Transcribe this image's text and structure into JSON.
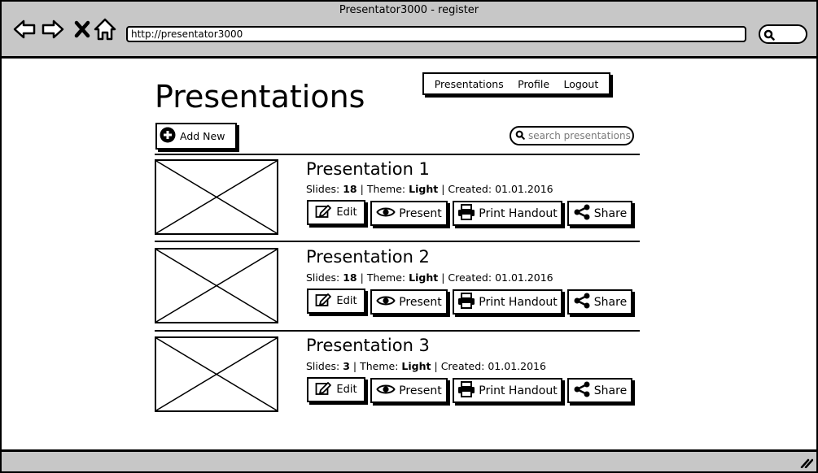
{
  "browser": {
    "title": "Presentator3000 - register",
    "url": "http://presentator3000"
  },
  "page": {
    "title": "Presentations"
  },
  "nav": {
    "items": [
      "Presentations",
      "Profile",
      "Logout"
    ]
  },
  "toolbar": {
    "add_new_label": "Add New",
    "search_placeholder": "search presentations"
  },
  "labels": {
    "slides": "Slides:",
    "theme": "Theme:",
    "created": "Created:",
    "sep": "|"
  },
  "actions": {
    "edit": "Edit",
    "present": "Present",
    "print": "Print Handout",
    "share": "Share"
  },
  "presentations": [
    {
      "name": "Presentation 1",
      "slides": "18",
      "theme": "Light",
      "created": "01.01.2016"
    },
    {
      "name": "Presentation 2",
      "slides": "18",
      "theme": "Light",
      "created": "01.01.2016"
    },
    {
      "name": "Presentation 3",
      "slides": "3",
      "theme": "Light",
      "created": "01.01.2016"
    }
  ]
}
